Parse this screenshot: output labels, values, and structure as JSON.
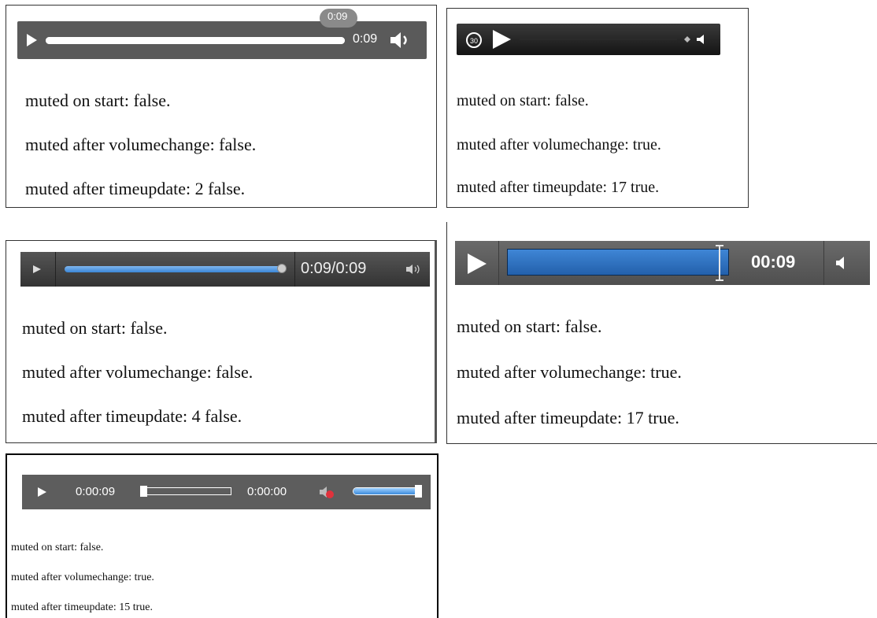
{
  "panels": [
    {
      "player": {
        "time": "0:09",
        "tooltip": "0:09",
        "progress": 1.0
      },
      "lines": [
        "muted on start: false.",
        "muted after volumechange: false.",
        "muted after timeupdate: 2 false."
      ],
      "icons": [
        "play-icon",
        "volume-icon"
      ]
    },
    {
      "player": {
        "skip_label": "30",
        "progress": 0.0
      },
      "lines": [
        "muted on start: false.",
        "muted after volumechange: true.",
        "muted after timeupdate: 17 true."
      ],
      "icons": [
        "skip-back-30-icon",
        "play-icon",
        "volume-icon"
      ]
    },
    {
      "player": {
        "time": "0:09/0:09",
        "progress": 1.0
      },
      "lines": [
        "muted on start: false.",
        "muted after volumechange: false.",
        "muted after timeupdate: 4 false."
      ],
      "icons": [
        "play-icon",
        "volume-icon"
      ]
    },
    {
      "player": {
        "time": "00:09",
        "progress": 1.0,
        "accent": "#2e6fbf"
      },
      "lines": [
        "muted on start: false.",
        "muted after volumechange: true.",
        "muted after timeupdate: 17 true."
      ],
      "icons": [
        "play-icon",
        "volume-icon"
      ]
    },
    {
      "player": {
        "current_time": "0:00:09",
        "duration": "0:00:00",
        "progress": 0.0,
        "volume_level": 1.0,
        "muted_color": "#e0323c"
      },
      "lines": [
        "muted on start: false.",
        "muted after volumechange: true.",
        "muted after timeupdate: 15 true."
      ],
      "icons": [
        "play-icon",
        "muted-volume-icon"
      ]
    }
  ]
}
